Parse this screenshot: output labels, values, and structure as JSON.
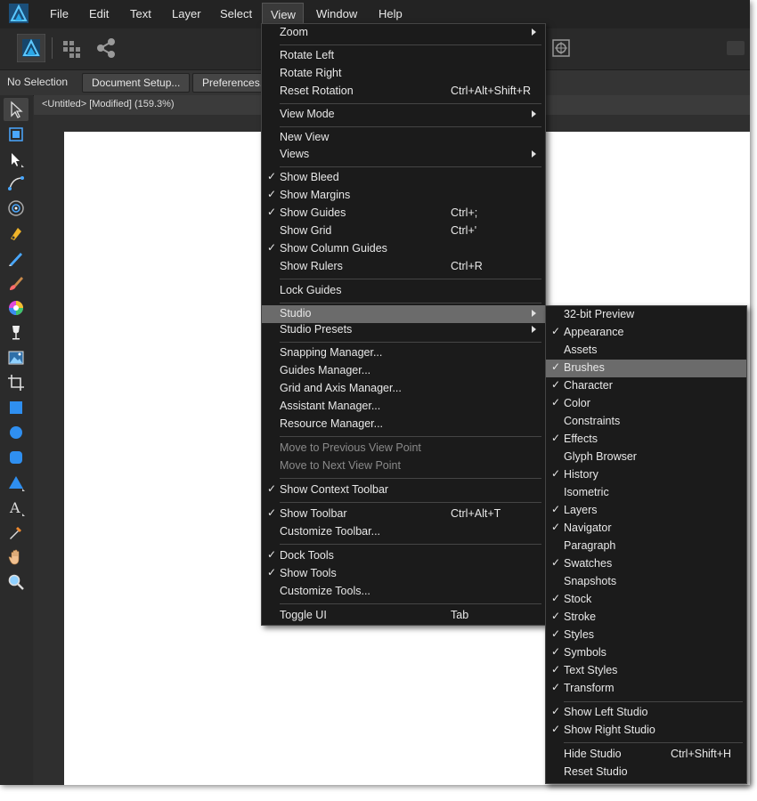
{
  "menubar": {
    "items": [
      "File",
      "Edit",
      "Text",
      "Layer",
      "Select",
      "View",
      "Window",
      "Help"
    ]
  },
  "toolbar": {
    "icons": [
      "affinity-publisher-persona-icon",
      "designer-persona-icon",
      "share-icon",
      "snapping-icon"
    ]
  },
  "context_toolbar": {
    "selection_label": "No Selection",
    "document_setup": "Document Setup...",
    "preferences": "Preferences..."
  },
  "document_tab": {
    "title": "<Untitled> [Modified] (159.3%)"
  },
  "tools": [
    "move-tool-icon",
    "artboard-tool-icon",
    "node-tool-icon",
    "corner-tool-icon",
    "target-icon",
    "pen-tool-icon",
    "pencil-tool-icon",
    "brush-tool-icon",
    "color-picker-wheel-icon",
    "wine-glass-icon",
    "picture-frame-icon",
    "crop-tool-icon",
    "rectangle-tool-icon",
    "ellipse-tool-icon",
    "rounded-rectangle-tool-icon",
    "triangle-tool-icon",
    "text-tool-icon",
    "eyedropper-tool-icon",
    "hand-tool-icon",
    "zoom-tool-icon"
  ],
  "view_menu": {
    "zoom": "Zoom",
    "rotate_left": "Rotate Left",
    "rotate_right": "Rotate Right",
    "reset_rotation": "Reset Rotation",
    "reset_rotation_sc": "Ctrl+Alt+Shift+R",
    "view_mode": "View Mode",
    "new_view": "New View",
    "views": "Views",
    "show_bleed": "Show Bleed",
    "show_margins": "Show Margins",
    "show_guides": "Show Guides",
    "show_guides_sc": "Ctrl+;",
    "show_grid": "Show Grid",
    "show_grid_sc": "Ctrl+'",
    "show_column_guides": "Show Column Guides",
    "show_rulers": "Show Rulers",
    "show_rulers_sc": "Ctrl+R",
    "lock_guides": "Lock Guides",
    "studio": "Studio",
    "studio_presets": "Studio Presets",
    "snapping_manager": "Snapping Manager...",
    "guides_manager": "Guides Manager...",
    "grid_axis_manager": "Grid and Axis Manager...",
    "assistant_manager": "Assistant Manager...",
    "resource_manager": "Resource Manager...",
    "move_prev_view": "Move to Previous View Point",
    "move_next_view": "Move to Next View Point",
    "show_context_toolbar": "Show Context Toolbar",
    "show_toolbar": "Show Toolbar",
    "show_toolbar_sc": "Ctrl+Alt+T",
    "customize_toolbar": "Customize Toolbar...",
    "dock_tools": "Dock Tools",
    "show_tools": "Show Tools",
    "customize_tools": "Customize Tools...",
    "toggle_ui": "Toggle UI",
    "toggle_ui_sc": "Tab",
    "check": "✓"
  },
  "studio_menu": {
    "preview_32bit": "32-bit Preview",
    "appearance": "Appearance",
    "assets": "Assets",
    "brushes": "Brushes",
    "character": "Character",
    "color": "Color",
    "constraints": "Constraints",
    "effects": "Effects",
    "glyph_browser": "Glyph Browser",
    "history": "History",
    "isometric": "Isometric",
    "layers": "Layers",
    "navigator": "Navigator",
    "paragraph": "Paragraph",
    "swatches": "Swatches",
    "snapshots": "Snapshots",
    "stock": "Stock",
    "stroke": "Stroke",
    "styles": "Styles",
    "symbols": "Symbols",
    "text_styles": "Text Styles",
    "transform": "Transform",
    "show_left_studio": "Show Left Studio",
    "show_right_studio": "Show Right Studio",
    "hide_studio": "Hide Studio",
    "hide_studio_sc": "Ctrl+Shift+H",
    "reset_studio": "Reset Studio"
  },
  "colors": {
    "accent": "#1fa3f0",
    "menu_bg": "#1b1b1b",
    "highlight": "#6b6b6b"
  }
}
